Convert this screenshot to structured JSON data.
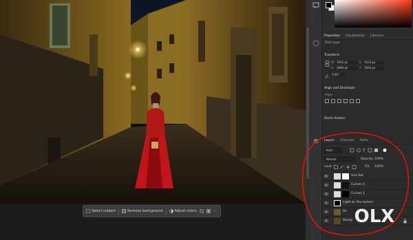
{
  "color": {
    "foreground": "#000000",
    "background": "#ffffff",
    "picker_hue": "#ff3b16"
  },
  "properties_tabs": [
    "Properties",
    "Adjustments",
    "Libraries"
  ],
  "properties": {
    "layer_type": "Pixel Layer",
    "transform_label": "Transform",
    "w_label": "W",
    "w_value": "1042 px",
    "x_label": "X",
    "x_value": "1613 px",
    "h_label": "H",
    "h_value": "1684 px",
    "y_label": "Y",
    "y_value": "1604 px",
    "angle_value": "0.00°",
    "align_label": "Align and Distribute",
    "align_sub": "Align:",
    "quick_actions_label": "Quick Actions"
  },
  "layers_tabs": [
    "Layers",
    "Channels",
    "Paths"
  ],
  "layers_panel": {
    "kind_value": "Kind",
    "blend_mode": "Normal",
    "opacity_label": "Opacity:",
    "opacity_value": "100%",
    "lock_label": "Lock:",
    "fill_label": "Fill:",
    "fill_value": "100%"
  },
  "layers": [
    {
      "name": "Hue Sat",
      "thumb": "#dddddd",
      "mask": true
    },
    {
      "name": "Curves 2",
      "thumb": "#dddddd",
      "mask": true
    },
    {
      "name": "Curves 1",
      "thumb": "#dddddd",
      "mask": true
    },
    {
      "name": "Light on the lantern",
      "thumb": "#000000",
      "mask": false
    },
    {
      "name": "Bo",
      "thumb": "#6a5a3a",
      "mask": false
    },
    {
      "name": "Backg",
      "thumb": "#5a4a20",
      "mask": false
    }
  ],
  "taskbar": {
    "select_subject": "Select subject",
    "remove_background": "Remove background",
    "adjust_colors": "Adjust colors",
    "more": "···"
  },
  "watermark": {
    "brand": "OLX"
  },
  "icons": {
    "eye": "eye-icon",
    "lock": "lock-icon",
    "more": "more-icon"
  }
}
